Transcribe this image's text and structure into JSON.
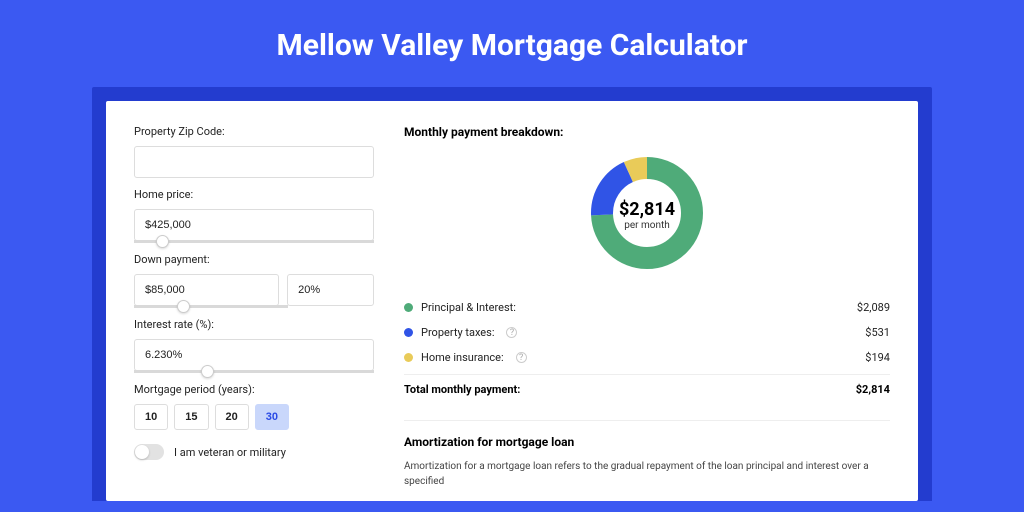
{
  "title": "Mellow Valley Mortgage Calculator",
  "form": {
    "zip_label": "Property Zip Code:",
    "zip_value": "",
    "home_price_label": "Home price:",
    "home_price_value": "$425,000",
    "down_payment_label": "Down payment:",
    "down_payment_value": "$85,000",
    "down_payment_pct": "20%",
    "interest_label": "Interest rate (%):",
    "interest_value": "6.230%",
    "period_label": "Mortgage period (years):",
    "periods": [
      "10",
      "15",
      "20",
      "30"
    ],
    "period_selected": "30",
    "veteran_label": "I am veteran or military"
  },
  "breakdown": {
    "title": "Monthly payment breakdown:",
    "donut_amount": "$2,814",
    "donut_sub": "per month",
    "items": [
      {
        "label": "Principal & Interest:",
        "value": "$2,089",
        "color": "green"
      },
      {
        "label": "Property taxes:",
        "value": "$531",
        "color": "blue",
        "info": true
      },
      {
        "label": "Home insurance:",
        "value": "$194",
        "color": "yellow",
        "info": true
      }
    ],
    "total_label": "Total monthly payment:",
    "total_value": "$2,814"
  },
  "amort": {
    "title": "Amortization for mortgage loan",
    "text": "Amortization for a mortgage loan refers to the gradual repayment of the loan principal and interest over a specified"
  },
  "chart_data": {
    "type": "pie",
    "title": "Monthly payment breakdown",
    "series": [
      {
        "name": "Principal & Interest",
        "value": 2089,
        "color": "#4fab79"
      },
      {
        "name": "Property taxes",
        "value": 531,
        "color": "#3054e6"
      },
      {
        "name": "Home insurance",
        "value": 194,
        "color": "#e9cb59"
      }
    ],
    "total": 2814,
    "center_label": "$2,814 per month"
  }
}
